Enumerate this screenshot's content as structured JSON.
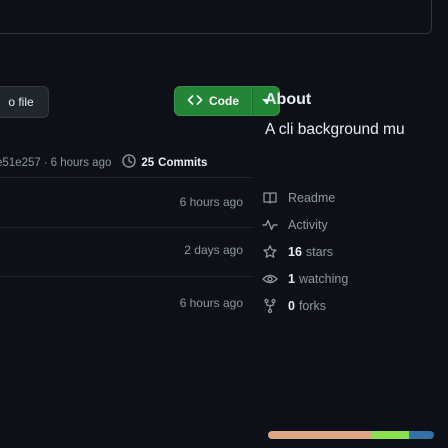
{
  "toolbar": {
    "go_to_file_label": "o file",
    "code_button_label": "Code"
  },
  "commit": {
    "hash": "e51e257",
    "separator": "·",
    "age": "6 hours ago",
    "commits_count": "25",
    "commits_label": "Commits"
  },
  "files": {
    "ages": [
      "6 hours ago",
      "2 days ago",
      "6 hours ago"
    ]
  },
  "about": {
    "title": "About",
    "description": "A cli background mu",
    "readme_label": "Readme",
    "activity_label": "Activity",
    "stars_count": "16",
    "stars_label": "stars",
    "watching_count": "1",
    "watching_label": "watching",
    "forks_count": "0",
    "forks_label": "forks"
  },
  "colors": {
    "background": "#0d1117",
    "border": "#30363d",
    "code_button": "#238636",
    "text_primary": "#e6edf3",
    "text_muted": "#8d96a0"
  },
  "icons": {
    "code": "code-icon",
    "caret": "triangle-down-icon",
    "history": "history-icon",
    "readme": "book-icon",
    "activity": "pulse-icon",
    "stars": "star-icon",
    "watching": "eye-icon",
    "forks": "repo-forked-icon"
  }
}
